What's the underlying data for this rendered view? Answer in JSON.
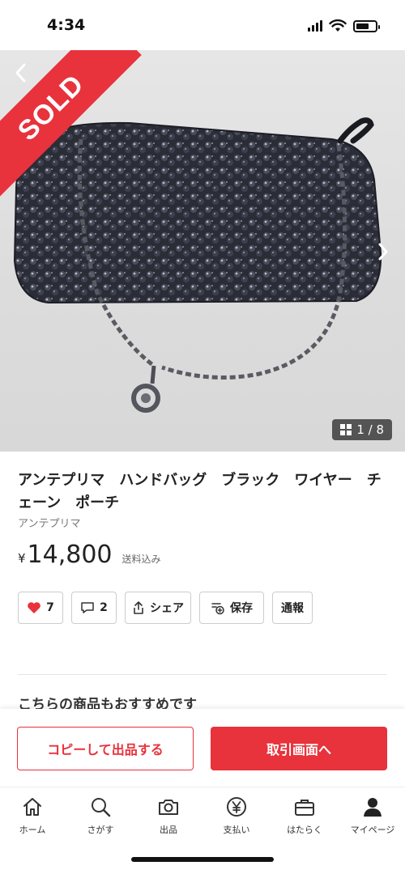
{
  "status_bar": {
    "time": "4:34"
  },
  "image": {
    "sold_label": "SOLD",
    "counter": "1 / 8"
  },
  "product": {
    "title": "アンテプリマ　ハンドバッグ　ブラック　ワイヤー　チェーン　ポーチ",
    "brand": "アンテプリマ",
    "price_currency": "¥",
    "price": "14,800",
    "price_note": "送料込み"
  },
  "actions": {
    "like_count": "7",
    "comment_count": "2",
    "share_label": "シェア",
    "save_label": "保存",
    "report_label": "通報"
  },
  "recommend": {
    "heading": "こちらの商品もおすすめです"
  },
  "cta": {
    "copy_label": "コピーして出品する",
    "trade_label": "取引画面へ"
  },
  "tabs": [
    {
      "label": "ホーム",
      "icon": "home-icon"
    },
    {
      "label": "さがす",
      "icon": "search-icon"
    },
    {
      "label": "出品",
      "icon": "camera-icon"
    },
    {
      "label": "支払い",
      "icon": "yen-icon"
    },
    {
      "label": "はたらく",
      "icon": "briefcase-icon"
    },
    {
      "label": "マイページ",
      "icon": "person-icon"
    }
  ],
  "colors": {
    "accent": "#e8323c",
    "heart": "#e8323c"
  }
}
